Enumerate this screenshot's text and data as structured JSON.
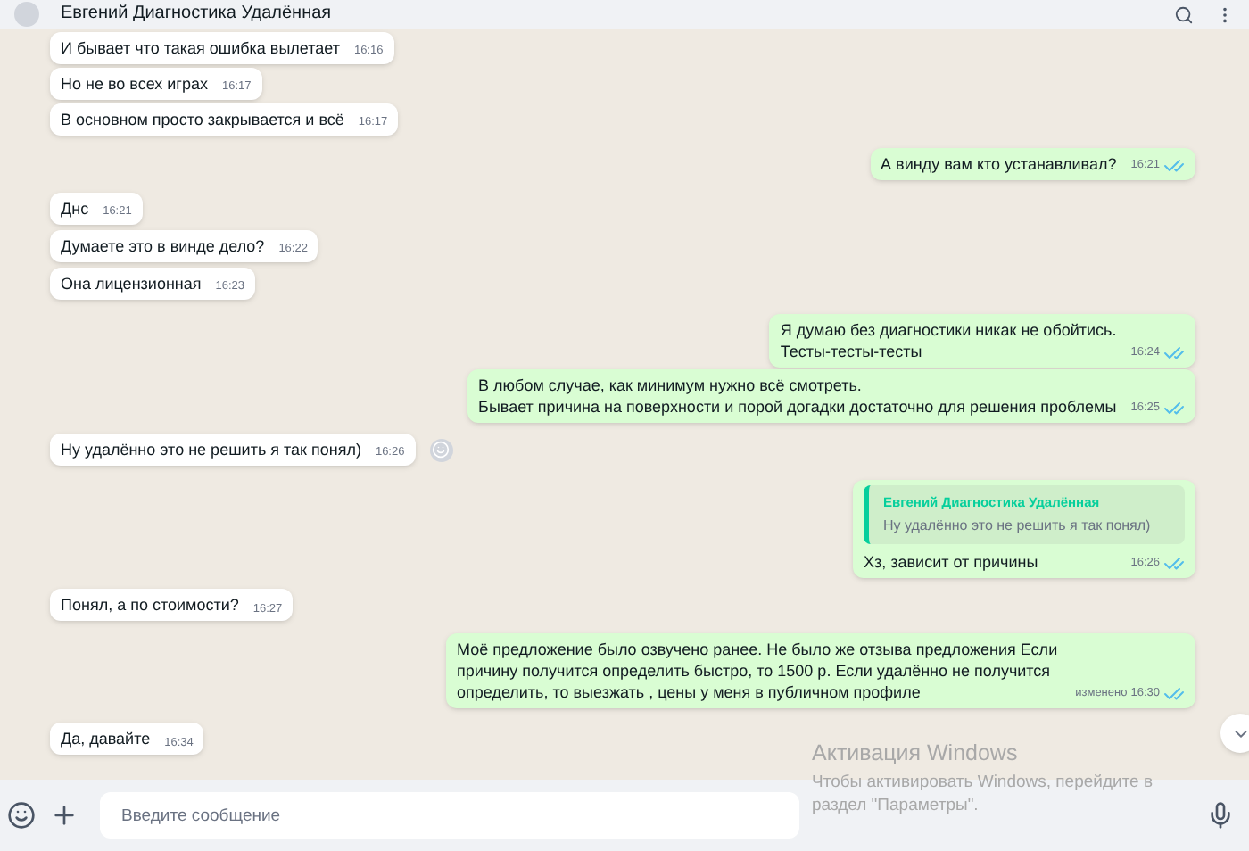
{
  "header": {
    "title": "Евгений Диагностика Удалённая"
  },
  "messages": [
    {
      "kind": "incoming",
      "text": "И бывает что такая ошибка вылетает",
      "time": "16:16"
    },
    {
      "kind": "incoming",
      "text": "Но не во всех играх",
      "time": "16:17"
    },
    {
      "kind": "incoming",
      "text": "В основном просто закрывается и всё",
      "time": "16:17"
    },
    {
      "kind": "outgoing",
      "text": "А винду вам кто устанавливал?",
      "time": "16:21",
      "read": true
    },
    {
      "kind": "incoming",
      "text": "Днс",
      "time": "16:21"
    },
    {
      "kind": "incoming",
      "text": "Думаете это в винде дело?",
      "time": "16:22"
    },
    {
      "kind": "incoming",
      "text": "Она лицензионная",
      "time": "16:23"
    },
    {
      "kind": "outgoing",
      "text": "Я думаю без диагностики никак не обойтись.\nТесты-тесты-тесты",
      "time": "16:24",
      "read": true
    },
    {
      "kind": "outgoing",
      "text": "В любом случае, как минимум нужно всё смотреть.\nБывает причина на поверхности и порой догадки достаточно для решения проблемы",
      "time": "16:25",
      "read": true
    },
    {
      "kind": "incoming",
      "text": "Ну удалённо это не решить я так понял)",
      "time": "16:26",
      "reaction_button": true
    },
    {
      "kind": "outgoing",
      "quote": {
        "author": "Евгений Диагностика Удалённая",
        "text": "Ну удалённо это не решить я так понял)"
      },
      "text": "Хз, зависит от причины",
      "time": "16:26",
      "read": true
    },
    {
      "kind": "incoming",
      "text": "Понял, а по стоимости?",
      "time": "16:27"
    },
    {
      "kind": "outgoing",
      "text": "Моё предложение было озвучено ранее. Не было же отзыва предложения Если причину получится определить быстро, то 1500 р.  Если удалённо не получится определить, то выезжать , цены у меня в публичном профиле",
      "edited": "изменено",
      "time": "16:30",
      "read": true
    },
    {
      "kind": "incoming",
      "text": "Да, давайте",
      "time": "16:34"
    }
  ],
  "composer": {
    "placeholder": "Введите сообщение"
  },
  "activation_notice": {
    "title": "Активация Windows",
    "text": "Чтобы активировать Windows, перейдите в раздел \"Параметры\"."
  }
}
